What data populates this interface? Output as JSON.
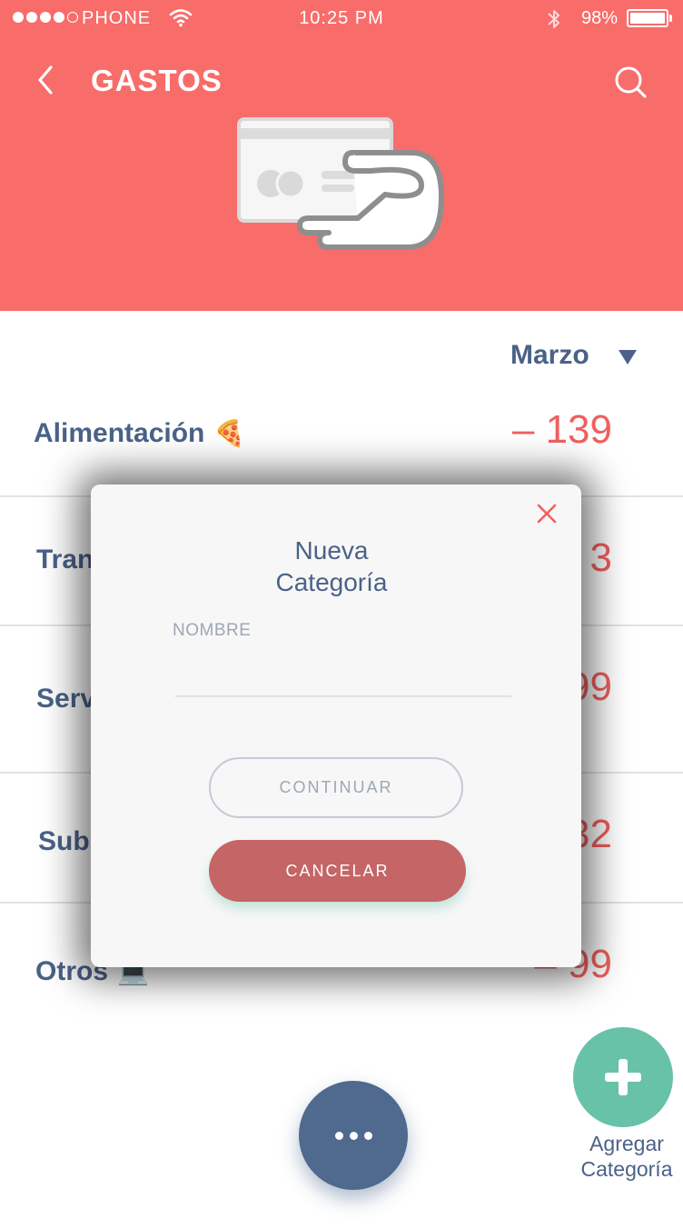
{
  "status_bar": {
    "carrier": "PHONE",
    "time": "10:25 PM",
    "battery": "98%"
  },
  "header": {
    "title": "GASTOS",
    "back_icon": "chevron-left-icon",
    "search_icon": "search-icon",
    "illustration": "card-payment-hand-icon"
  },
  "month_selector": {
    "value": "Marzo"
  },
  "categories": [
    {
      "label": "Alimentación",
      "emoji": "🍕",
      "amount": "– 139"
    },
    {
      "label": "Tran",
      "emoji": "",
      "amount": "3"
    },
    {
      "label": "Serv",
      "emoji": "",
      "amount": "99"
    },
    {
      "label": "Subs",
      "emoji": "",
      "amount": "32"
    },
    {
      "label": "Otros",
      "emoji": "💻",
      "amount": "– 99"
    }
  ],
  "fab_add": {
    "label": "Agregar Categoría"
  },
  "modal": {
    "title": "Nueva Categoría",
    "field_label": "NOMBRE",
    "field_value": "",
    "continue_label": "CONTINUAR",
    "cancel_label": "CANCELAR"
  },
  "colors": {
    "header_bg": "#f86c6a",
    "primary_text": "#4a6288",
    "amount": "#f0605f",
    "fab_more": "#4f6a8e",
    "fab_add": "#67c2a8",
    "cancel_button": "#c56566"
  }
}
